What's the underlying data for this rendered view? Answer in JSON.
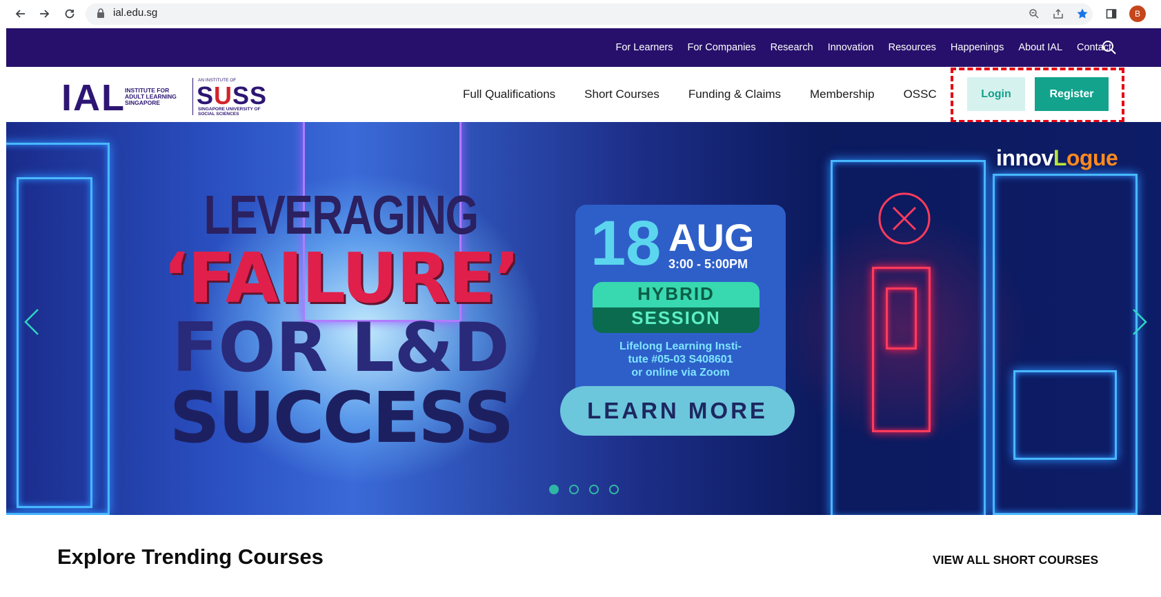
{
  "browser": {
    "url": "ial.edu.sg",
    "profile_initial": "B",
    "icons": [
      "back-icon",
      "forward-icon",
      "reload-icon",
      "lock-icon",
      "zoom-icon",
      "share-icon",
      "bookmark-star-icon",
      "side-panel-icon"
    ]
  },
  "topbar": {
    "links": [
      "For Learners",
      "For Companies",
      "Research",
      "Innovation",
      "Resources",
      "Happenings",
      "About IAL",
      "Contact"
    ]
  },
  "logo": {
    "ial": "IAL",
    "ial_sub": "INSTITUTE FOR ADULT LEARNING SINGAPORE",
    "suss_small": "AN INSTITUTE OF",
    "suss_s1": "S",
    "suss_u": "U",
    "suss_ss": "SS",
    "suss_sub": "SINGAPORE UNIVERSITY OF SOCIAL SCIENCES"
  },
  "mainnav": {
    "items": [
      "Full Qualifications",
      "Short Courses",
      "Funding & Claims",
      "Membership",
      "OSSC"
    ],
    "login": "Login",
    "register": "Register"
  },
  "hero": {
    "line1": "LEVERAGING",
    "line2": "‘FAILURE’",
    "line3": "FOR L&D",
    "line4": "SUCCESS",
    "date_day": "18",
    "date_month": "AUG",
    "time": "3:00 - 5:00PM",
    "hybrid1": "HYBRID",
    "hybrid2": "SESSION",
    "venue": "Lifelong Learning Insti-\ntute #05-03 S408601\nor online via Zoom",
    "cta": "LEARN MORE",
    "brand_a": "innov",
    "brand_b": "L",
    "brand_c": "ogue",
    "slides": 4,
    "active_slide": 1
  },
  "section": {
    "title": "Explore Trending Courses",
    "view_all": "VIEW ALL SHORT COURSES"
  },
  "colors": {
    "topbar": "#27106b",
    "accent": "#13a38d",
    "highlight": "#e60012"
  }
}
